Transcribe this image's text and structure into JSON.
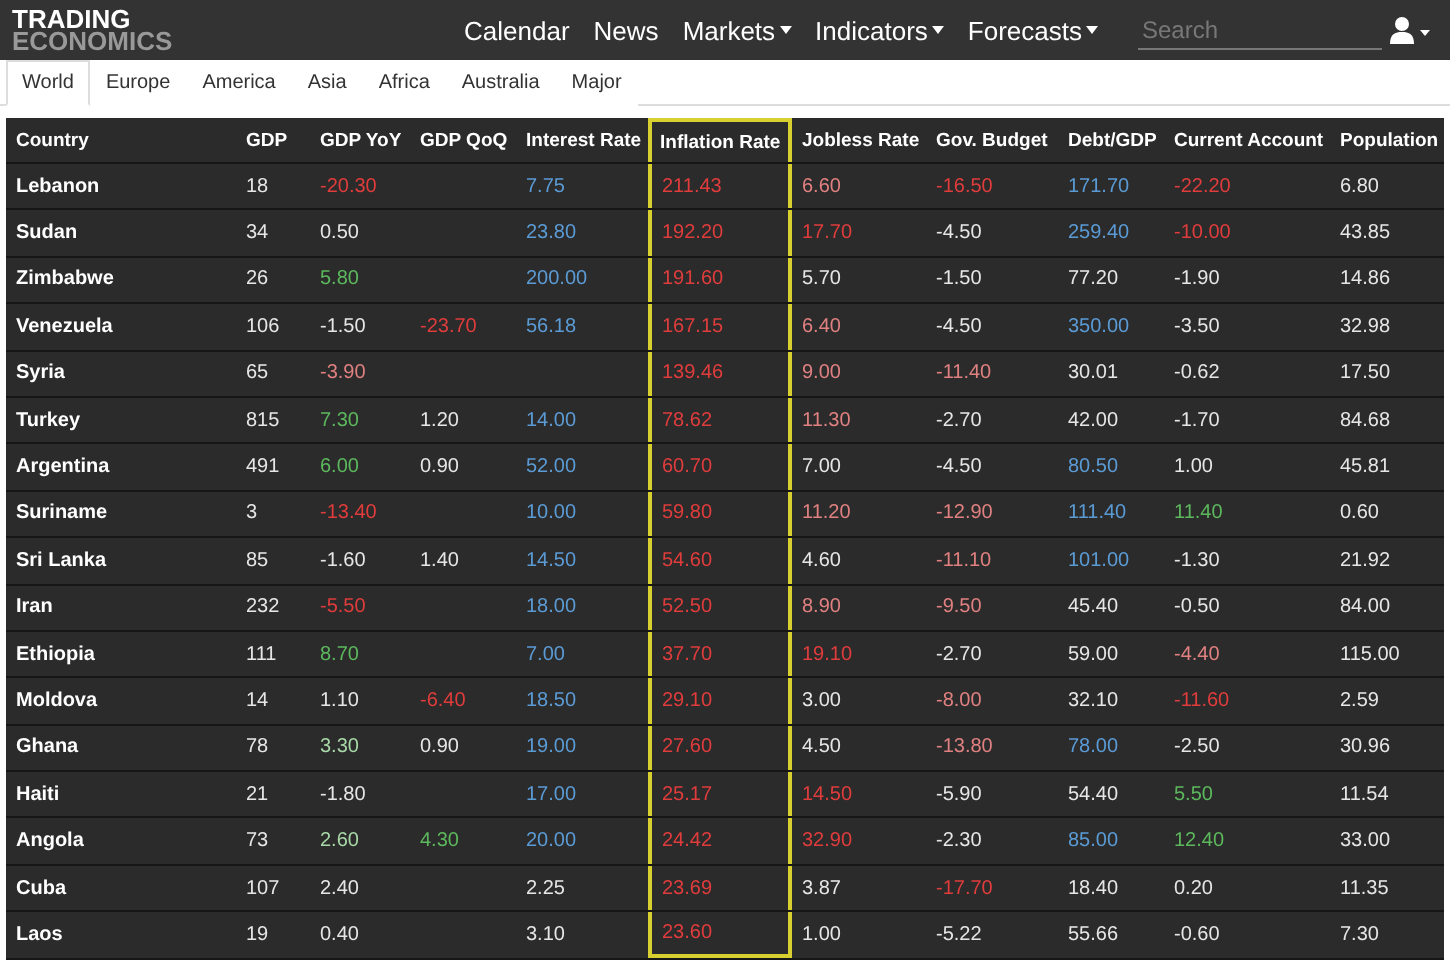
{
  "logo": {
    "line_1": "TRADING",
    "line_2": "ECONOMICS"
  },
  "nav": [
    {
      "label": "Calendar",
      "dropdown": false
    },
    {
      "label": "News",
      "dropdown": false
    },
    {
      "label": "Markets",
      "dropdown": true
    },
    {
      "label": "Indicators",
      "dropdown": true
    },
    {
      "label": "Forecasts",
      "dropdown": true
    }
  ],
  "search": {
    "placeholder": "Search"
  },
  "tabs": [
    {
      "label": "World",
      "selected": true
    },
    {
      "label": "Europe",
      "selected": false
    },
    {
      "label": "America",
      "selected": false
    },
    {
      "label": "Asia",
      "selected": false
    },
    {
      "label": "Africa",
      "selected": false
    },
    {
      "label": "Australia",
      "selected": false
    },
    {
      "label": "Major",
      "selected": false
    }
  ],
  "table": {
    "columns": [
      {
        "label": "Country",
        "highlighted": false
      },
      {
        "label": "GDP",
        "highlighted": false
      },
      {
        "label": "GDP YoY",
        "highlighted": false
      },
      {
        "label": "GDP QoQ",
        "highlighted": false
      },
      {
        "label": "Interest Rate",
        "highlighted": false
      },
      {
        "label": "Inflation Rate",
        "highlighted": true
      },
      {
        "label": "Jobless Rate",
        "highlighted": false
      },
      {
        "label": "Gov. Budget",
        "highlighted": false
      },
      {
        "label": "Debt/GDP",
        "highlighted": false
      },
      {
        "label": "Current Account",
        "highlighted": false
      },
      {
        "label": "Population",
        "highlighted": false
      }
    ],
    "rows": [
      {
        "cells": [
          {
            "text": "Lebanon",
            "color": "#ffffff"
          },
          {
            "text": "18",
            "color": "#e6e6e6"
          },
          {
            "text": "-20.30",
            "color": "#e03c3c"
          },
          "",
          {
            "text": "7.75",
            "color": "#5b9bd5"
          },
          {
            "text": "211.43",
            "color": "#e03c3c"
          },
          {
            "text": "6.60",
            "color": "#e08080"
          },
          {
            "text": "-16.50",
            "color": "#e03c3c"
          },
          {
            "text": "171.70",
            "color": "#5b9bd5"
          },
          {
            "text": "-22.20",
            "color": "#e03c3c"
          },
          {
            "text": "6.80",
            "color": "#e6e6e6"
          }
        ]
      },
      {
        "cells": [
          {
            "text": "Sudan",
            "color": "#ffffff"
          },
          {
            "text": "34",
            "color": "#e6e6e6"
          },
          {
            "text": "0.50",
            "color": "#e6e6e6"
          },
          "",
          {
            "text": "23.80",
            "color": "#5b9bd5"
          },
          {
            "text": "192.20",
            "color": "#e03c3c"
          },
          {
            "text": "17.70",
            "color": "#e03c3c"
          },
          {
            "text": "-4.50",
            "color": "#e6e6e6"
          },
          {
            "text": "259.40",
            "color": "#5b9bd5"
          },
          {
            "text": "-10.00",
            "color": "#e03c3c"
          },
          {
            "text": "43.85",
            "color": "#e6e6e6"
          }
        ]
      },
      {
        "cells": [
          {
            "text": "Zimbabwe",
            "color": "#ffffff"
          },
          {
            "text": "26",
            "color": "#e6e6e6"
          },
          {
            "text": "5.80",
            "color": "#5cb85c"
          },
          "",
          {
            "text": "200.00",
            "color": "#5b9bd5"
          },
          {
            "text": "191.60",
            "color": "#e03c3c"
          },
          {
            "text": "5.70",
            "color": "#e6e6e6"
          },
          {
            "text": "-1.50",
            "color": "#e6e6e6"
          },
          {
            "text": "77.20",
            "color": "#e6e6e6"
          },
          {
            "text": "-1.90",
            "color": "#e6e6e6"
          },
          {
            "text": "14.86",
            "color": "#e6e6e6"
          }
        ]
      },
      {
        "cells": [
          {
            "text": "Venezuela",
            "color": "#ffffff"
          },
          {
            "text": "106",
            "color": "#e6e6e6"
          },
          {
            "text": "-1.50",
            "color": "#e6e6e6"
          },
          {
            "text": "-23.70",
            "color": "#e03c3c"
          },
          {
            "text": "56.18",
            "color": "#5b9bd5"
          },
          {
            "text": "167.15",
            "color": "#e03c3c"
          },
          {
            "text": "6.40",
            "color": "#e08080"
          },
          {
            "text": "-4.50",
            "color": "#e6e6e6"
          },
          {
            "text": "350.00",
            "color": "#5b9bd5"
          },
          {
            "text": "-3.50",
            "color": "#e6e6e6"
          },
          {
            "text": "32.98",
            "color": "#e6e6e6"
          }
        ]
      },
      {
        "cells": [
          {
            "text": "Syria",
            "color": "#ffffff"
          },
          {
            "text": "65",
            "color": "#e6e6e6"
          },
          {
            "text": "-3.90",
            "color": "#e08080"
          },
          "",
          "",
          {
            "text": "139.46",
            "color": "#e03c3c"
          },
          {
            "text": "9.00",
            "color": "#e08080"
          },
          {
            "text": "-11.40",
            "color": "#e08080"
          },
          {
            "text": "30.01",
            "color": "#e6e6e6"
          },
          {
            "text": "-0.62",
            "color": "#e6e6e6"
          },
          {
            "text": "17.50",
            "color": "#e6e6e6"
          }
        ]
      },
      {
        "cells": [
          {
            "text": "Turkey",
            "color": "#ffffff"
          },
          {
            "text": "815",
            "color": "#e6e6e6"
          },
          {
            "text": "7.30",
            "color": "#5cb85c"
          },
          {
            "text": "1.20",
            "color": "#e6e6e6"
          },
          {
            "text": "14.00",
            "color": "#5b9bd5"
          },
          {
            "text": "78.62",
            "color": "#e03c3c"
          },
          {
            "text": "11.30",
            "color": "#e08080"
          },
          {
            "text": "-2.70",
            "color": "#e6e6e6"
          },
          {
            "text": "42.00",
            "color": "#e6e6e6"
          },
          {
            "text": "-1.70",
            "color": "#e6e6e6"
          },
          {
            "text": "84.68",
            "color": "#e6e6e6"
          }
        ]
      },
      {
        "cells": [
          {
            "text": "Argentina",
            "color": "#ffffff"
          },
          {
            "text": "491",
            "color": "#e6e6e6"
          },
          {
            "text": "6.00",
            "color": "#5cb85c"
          },
          {
            "text": "0.90",
            "color": "#e6e6e6"
          },
          {
            "text": "52.00",
            "color": "#5b9bd5"
          },
          {
            "text": "60.70",
            "color": "#e03c3c"
          },
          {
            "text": "7.00",
            "color": "#e6e6e6"
          },
          {
            "text": "-4.50",
            "color": "#e6e6e6"
          },
          {
            "text": "80.50",
            "color": "#5b9bd5"
          },
          {
            "text": "1.00",
            "color": "#e6e6e6"
          },
          {
            "text": "45.81",
            "color": "#e6e6e6"
          }
        ]
      },
      {
        "cells": [
          {
            "text": "Suriname",
            "color": "#ffffff"
          },
          {
            "text": "3",
            "color": "#e6e6e6"
          },
          {
            "text": "-13.40",
            "color": "#e03c3c"
          },
          "",
          {
            "text": "10.00",
            "color": "#5b9bd5"
          },
          {
            "text": "59.80",
            "color": "#e03c3c"
          },
          {
            "text": "11.20",
            "color": "#e08080"
          },
          {
            "text": "-12.90",
            "color": "#e08080"
          },
          {
            "text": "111.40",
            "color": "#5b9bd5"
          },
          {
            "text": "11.40",
            "color": "#5cb85c"
          },
          {
            "text": "0.60",
            "color": "#e6e6e6"
          }
        ]
      },
      {
        "cells": [
          {
            "text": "Sri Lanka",
            "color": "#ffffff"
          },
          {
            "text": "85",
            "color": "#e6e6e6"
          },
          {
            "text": "-1.60",
            "color": "#e6e6e6"
          },
          {
            "text": "1.40",
            "color": "#e6e6e6"
          },
          {
            "text": "14.50",
            "color": "#5b9bd5"
          },
          {
            "text": "54.60",
            "color": "#e03c3c"
          },
          {
            "text": "4.60",
            "color": "#e6e6e6"
          },
          {
            "text": "-11.10",
            "color": "#e08080"
          },
          {
            "text": "101.00",
            "color": "#5b9bd5"
          },
          {
            "text": "-1.30",
            "color": "#e6e6e6"
          },
          {
            "text": "21.92",
            "color": "#e6e6e6"
          }
        ]
      },
      {
        "cells": [
          {
            "text": "Iran",
            "color": "#ffffff"
          },
          {
            "text": "232",
            "color": "#e6e6e6"
          },
          {
            "text": "-5.50",
            "color": "#e03c3c"
          },
          "",
          {
            "text": "18.00",
            "color": "#5b9bd5"
          },
          {
            "text": "52.50",
            "color": "#e03c3c"
          },
          {
            "text": "8.90",
            "color": "#e08080"
          },
          {
            "text": "-9.50",
            "color": "#e08080"
          },
          {
            "text": "45.40",
            "color": "#e6e6e6"
          },
          {
            "text": "-0.50",
            "color": "#e6e6e6"
          },
          {
            "text": "84.00",
            "color": "#e6e6e6"
          }
        ]
      },
      {
        "cells": [
          {
            "text": "Ethiopia",
            "color": "#ffffff"
          },
          {
            "text": "111",
            "color": "#e6e6e6"
          },
          {
            "text": "8.70",
            "color": "#5cb85c"
          },
          "",
          {
            "text": "7.00",
            "color": "#5b9bd5"
          },
          {
            "text": "37.70",
            "color": "#e03c3c"
          },
          {
            "text": "19.10",
            "color": "#e03c3c"
          },
          {
            "text": "-2.70",
            "color": "#e6e6e6"
          },
          {
            "text": "59.00",
            "color": "#e6e6e6"
          },
          {
            "text": "-4.40",
            "color": "#e08080"
          },
          {
            "text": "115.00",
            "color": "#e6e6e6"
          }
        ]
      },
      {
        "cells": [
          {
            "text": "Moldova",
            "color": "#ffffff"
          },
          {
            "text": "14",
            "color": "#e6e6e6"
          },
          {
            "text": "1.10",
            "color": "#e6e6e6"
          },
          {
            "text": "-6.40",
            "color": "#e03c3c"
          },
          {
            "text": "18.50",
            "color": "#5b9bd5"
          },
          {
            "text": "29.10",
            "color": "#e03c3c"
          },
          {
            "text": "3.00",
            "color": "#e6e6e6"
          },
          {
            "text": "-8.00",
            "color": "#e08080"
          },
          {
            "text": "32.10",
            "color": "#e6e6e6"
          },
          {
            "text": "-11.60",
            "color": "#e03c3c"
          },
          {
            "text": "2.59",
            "color": "#e6e6e6"
          }
        ]
      },
      {
        "cells": [
          {
            "text": "Ghana",
            "color": "#ffffff"
          },
          {
            "text": "78",
            "color": "#e6e6e6"
          },
          {
            "text": "3.30",
            "color": "#a8d8a8"
          },
          {
            "text": "0.90",
            "color": "#e6e6e6"
          },
          {
            "text": "19.00",
            "color": "#5b9bd5"
          },
          {
            "text": "27.60",
            "color": "#e03c3c"
          },
          {
            "text": "4.50",
            "color": "#e6e6e6"
          },
          {
            "text": "-13.80",
            "color": "#e08080"
          },
          {
            "text": "78.00",
            "color": "#5b9bd5"
          },
          {
            "text": "-2.50",
            "color": "#e6e6e6"
          },
          {
            "text": "30.96",
            "color": "#e6e6e6"
          }
        ]
      },
      {
        "cells": [
          {
            "text": "Haiti",
            "color": "#ffffff"
          },
          {
            "text": "21",
            "color": "#e6e6e6"
          },
          {
            "text": "-1.80",
            "color": "#e6e6e6"
          },
          "",
          {
            "text": "17.00",
            "color": "#5b9bd5"
          },
          {
            "text": "25.17",
            "color": "#e03c3c"
          },
          {
            "text": "14.50",
            "color": "#e03c3c"
          },
          {
            "text": "-5.90",
            "color": "#e6e6e6"
          },
          {
            "text": "54.40",
            "color": "#e6e6e6"
          },
          {
            "text": "5.50",
            "color": "#5cb85c"
          },
          {
            "text": "11.54",
            "color": "#e6e6e6"
          }
        ]
      },
      {
        "cells": [
          {
            "text": "Angola",
            "color": "#ffffff"
          },
          {
            "text": "73",
            "color": "#e6e6e6"
          },
          {
            "text": "2.60",
            "color": "#a8d8a8"
          },
          {
            "text": "4.30",
            "color": "#5cb85c"
          },
          {
            "text": "20.00",
            "color": "#5b9bd5"
          },
          {
            "text": "24.42",
            "color": "#e03c3c"
          },
          {
            "text": "32.90",
            "color": "#e03c3c"
          },
          {
            "text": "-2.30",
            "color": "#e6e6e6"
          },
          {
            "text": "85.00",
            "color": "#5b9bd5"
          },
          {
            "text": "12.40",
            "color": "#5cb85c"
          },
          {
            "text": "33.00",
            "color": "#e6e6e6"
          }
        ]
      },
      {
        "cells": [
          {
            "text": "Cuba",
            "color": "#ffffff"
          },
          {
            "text": "107",
            "color": "#e6e6e6"
          },
          {
            "text": "2.40",
            "color": "#e6e6e6"
          },
          "",
          {
            "text": "2.25",
            "color": "#e6e6e6"
          },
          {
            "text": "23.69",
            "color": "#e03c3c"
          },
          {
            "text": "3.87",
            "color": "#e6e6e6"
          },
          {
            "text": "-17.70",
            "color": "#e03c3c"
          },
          {
            "text": "18.40",
            "color": "#e6e6e6"
          },
          {
            "text": "0.20",
            "color": "#e6e6e6"
          },
          {
            "text": "11.35",
            "color": "#e6e6e6"
          }
        ]
      },
      {
        "cells": [
          {
            "text": "Laos",
            "color": "#ffffff"
          },
          {
            "text": "19",
            "color": "#e6e6e6"
          },
          {
            "text": "0.40",
            "color": "#e6e6e6"
          },
          "",
          {
            "text": "3.10",
            "color": "#e6e6e6"
          },
          {
            "text": "23.60",
            "color": "#e03c3c"
          },
          {
            "text": "1.00",
            "color": "#e6e6e6"
          },
          {
            "text": "-5.22",
            "color": "#e6e6e6"
          },
          {
            "text": "55.66",
            "color": "#e6e6e6"
          },
          {
            "text": "-0.60",
            "color": "#e6e6e6"
          },
          {
            "text": "7.30",
            "color": "#e6e6e6"
          }
        ]
      }
    ]
  }
}
